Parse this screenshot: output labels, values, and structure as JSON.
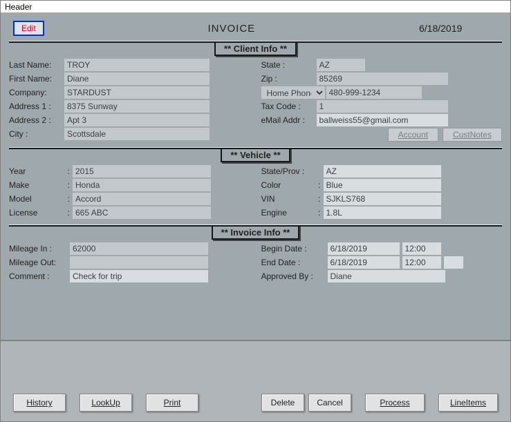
{
  "titlebar": "Header",
  "topbar": {
    "edit": "Edit",
    "title": "INVOICE",
    "date": "6/18/2019"
  },
  "sections": {
    "client": "** Client Info **",
    "vehicle": "**  Vehicle  **",
    "invoice": "**  Invoice Info  **"
  },
  "labels": {
    "lastName": "Last Name:",
    "firstName": "First Name:",
    "company": "Company:",
    "addr1": "Address 1 :",
    "addr2": "Address 2 :",
    "city": "City :",
    "state": "State :",
    "zip": "Zip :",
    "phoneType": "Home Phone",
    "taxCode": "Tax Code :",
    "email": "eMail Addr :",
    "account": "Account",
    "custNotes": "CustNotes",
    "year": "Year",
    "make": "Make",
    "model": "Model",
    "license": "License",
    "stateProv": "State/Prov :",
    "color": "Color",
    "vin": "VIN",
    "engine": "Engine",
    "mileIn": "Mileage In :",
    "mileOut": "Mileage Out:",
    "comment": "Comment :",
    "beginDate": "Begin Date :",
    "endDate": "End Date :",
    "approvedBy": "Approved By :",
    "colon": ":"
  },
  "client": {
    "lastName": "TROY",
    "firstName": "Diane",
    "company": "STARDUST",
    "addr1": "8375 Sunway",
    "addr2": "Apt 3",
    "city": "Scottsdale",
    "state": "AZ",
    "zip": "85269",
    "phone": "480-999-1234",
    "taxCode": "1",
    "email": "ballweiss55@gmail.com"
  },
  "vehicle": {
    "year": "2015",
    "make": "Honda",
    "model": "Accord",
    "license": "665 ABC",
    "stateProv": "AZ",
    "color": "Blue",
    "vin": "SJKLS768",
    "engine": "1.8L"
  },
  "invoice": {
    "mileIn": "62000",
    "mileOut": "",
    "comment": "Check for trip",
    "beginDate": "6/18/2019",
    "beginTime": "12:00",
    "endDate": "6/18/2019",
    "endTime": "12:00",
    "endExtra": "",
    "approvedBy": "Diane"
  },
  "footer": {
    "history": "History",
    "lookup": "LookUp",
    "print": "Print",
    "delete": "Delete",
    "cancel": "Cancel",
    "process": "Process",
    "lineItems": "LineItems"
  }
}
